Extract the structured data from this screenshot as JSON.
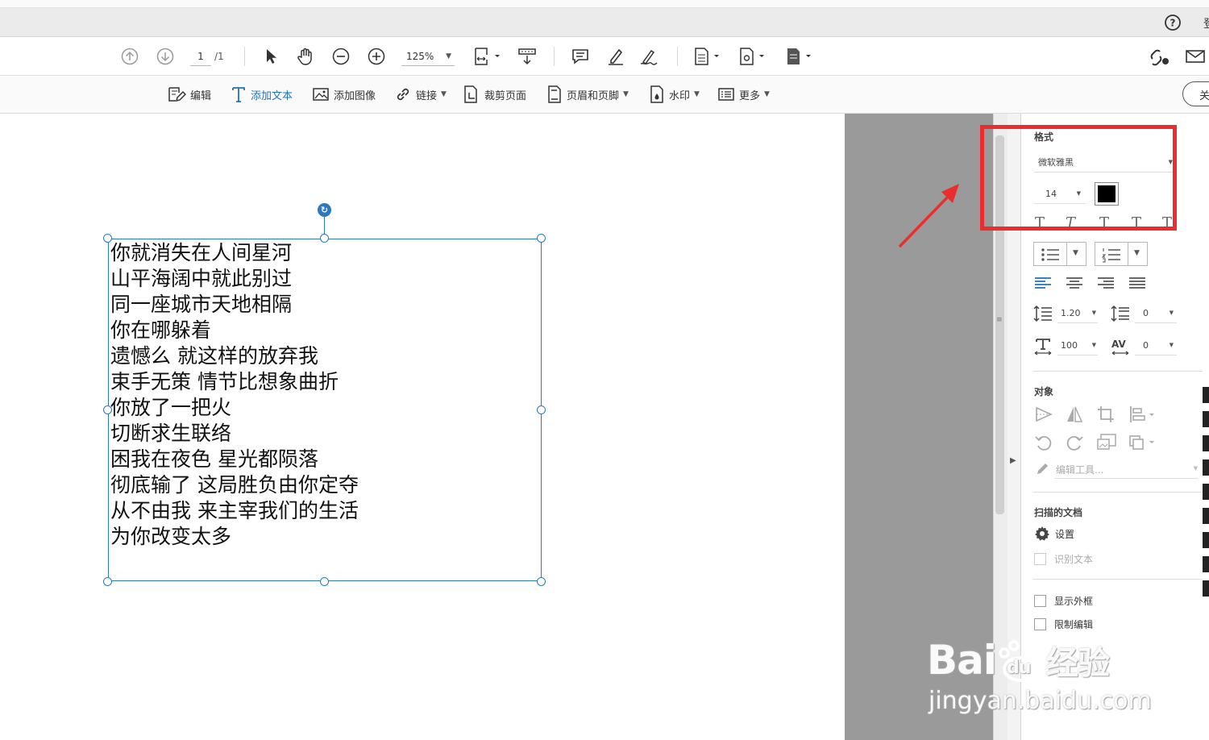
{
  "toolbar": {
    "page_current": "1",
    "page_total": "/1",
    "zoom": "125%"
  },
  "edit_toolbar": {
    "edit": "编辑",
    "add_text": "添加文本",
    "add_image": "添加图像",
    "link": "链接",
    "crop_page": "裁剪页面",
    "header_footer": "页眉和页脚",
    "watermark": "水印",
    "more": "更多",
    "close_partial": "关"
  },
  "menubar": {
    "partial_text": "登"
  },
  "document": {
    "lines": [
      "你就消失在人间星河",
      "山平海阔中就此别过",
      "同一座城市天地相隔",
      "你在哪躲着",
      "遗憾么 就这样的放弃我",
      "束手无策 情节比想象曲折",
      "你放了一把火",
      "切断求生联络",
      "困我在夜色 星光都陨落",
      "彻底输了 这局胜负由你定夺",
      "从不由我 来主宰我们的生活",
      "为你改变太多"
    ]
  },
  "format_panel": {
    "section_title": "格式",
    "font_name": "微软雅黑",
    "font_size": "14",
    "text_color": "#000000",
    "line_spacing": "1.20",
    "paragraph_spacing": "0",
    "horizontal_scale": "100",
    "char_spacing": "0"
  },
  "object_panel": {
    "section_title": "对象",
    "edit_tool": "编辑工具..."
  },
  "scan_panel": {
    "section_title": "扫描的文档",
    "settings": "设置",
    "recognize_text": "识别文本"
  },
  "options": {
    "show_bounding": "显示外框",
    "restrict_editing": "限制编辑"
  },
  "watermark_brand": {
    "main": "Bai",
    "paw": "du",
    "cn": "经验",
    "url": "jingyan.baidu.com"
  },
  "colors": {
    "accent_blue": "#1f73b7",
    "highlight_red": "#ec2d2d",
    "selection_blue": "#2c79c1"
  }
}
